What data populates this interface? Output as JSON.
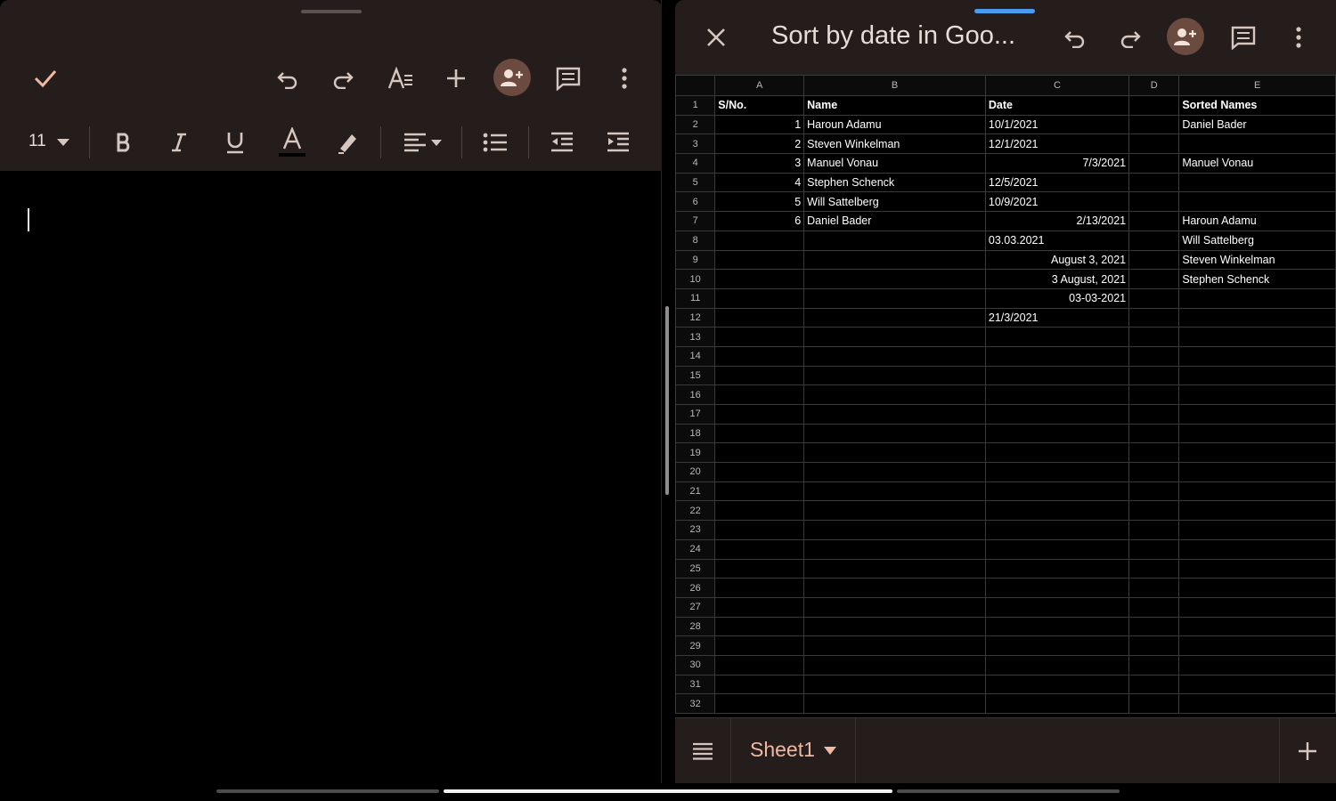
{
  "docs": {
    "font_size": "11"
  },
  "sheets": {
    "title": "Sort by date in Goo...",
    "tab_name": "Sheet1",
    "columns": [
      "A",
      "B",
      "C",
      "D",
      "E"
    ],
    "rows": [
      {
        "n": "1",
        "a": "S/No.",
        "b": "Name",
        "c": "Date",
        "d": "",
        "e": "Sorted Names"
      },
      {
        "n": "2",
        "a": "1",
        "b": "Haroun Adamu",
        "c": "10/1/2021",
        "d": "",
        "e": "Daniel Bader"
      },
      {
        "n": "3",
        "a": "2",
        "b": "Steven Winkelman",
        "c": "12/1/2021",
        "d": "",
        "e": ""
      },
      {
        "n": "4",
        "a": "3",
        "b": "Manuel Vonau",
        "c": "7/3/2021",
        "d": "",
        "e": "Manuel Vonau"
      },
      {
        "n": "5",
        "a": "4",
        "b": "Stephen Schenck",
        "c": "12/5/2021",
        "d": "",
        "e": ""
      },
      {
        "n": "6",
        "a": "5",
        "b": "Will Sattelberg",
        "c": "10/9/2021",
        "d": "",
        "e": ""
      },
      {
        "n": "7",
        "a": "6",
        "b": "Daniel Bader",
        "c": "2/13/2021",
        "d": "",
        "e": "Haroun Adamu"
      },
      {
        "n": "8",
        "a": "",
        "b": "",
        "c": "03.03.2021",
        "d": "",
        "e": "Will Sattelberg"
      },
      {
        "n": "9",
        "a": "",
        "b": "",
        "c": "August 3, 2021",
        "d": "",
        "e": "Steven Winkelman"
      },
      {
        "n": "10",
        "a": "",
        "b": "",
        "c": "3 August, 2021",
        "d": "",
        "e": "Stephen Schenck"
      },
      {
        "n": "11",
        "a": "",
        "b": "",
        "c": "03-03-2021",
        "d": "",
        "e": ""
      },
      {
        "n": "12",
        "a": "",
        "b": "",
        "c": "21/3/2021",
        "d": "",
        "e": ""
      },
      {
        "n": "13",
        "a": "",
        "b": "",
        "c": "",
        "d": "",
        "e": ""
      },
      {
        "n": "14",
        "a": "",
        "b": "",
        "c": "",
        "d": "",
        "e": ""
      },
      {
        "n": "15",
        "a": "",
        "b": "",
        "c": "",
        "d": "",
        "e": ""
      },
      {
        "n": "16",
        "a": "",
        "b": "",
        "c": "",
        "d": "",
        "e": ""
      },
      {
        "n": "17",
        "a": "",
        "b": "",
        "c": "",
        "d": "",
        "e": ""
      },
      {
        "n": "18",
        "a": "",
        "b": "",
        "c": "",
        "d": "",
        "e": ""
      },
      {
        "n": "19",
        "a": "",
        "b": "",
        "c": "",
        "d": "",
        "e": ""
      },
      {
        "n": "20",
        "a": "",
        "b": "",
        "c": "",
        "d": "",
        "e": ""
      },
      {
        "n": "21",
        "a": "",
        "b": "",
        "c": "",
        "d": "",
        "e": ""
      },
      {
        "n": "22",
        "a": "",
        "b": "",
        "c": "",
        "d": "",
        "e": ""
      },
      {
        "n": "23",
        "a": "",
        "b": "",
        "c": "",
        "d": "",
        "e": ""
      },
      {
        "n": "24",
        "a": "",
        "b": "",
        "c": "",
        "d": "",
        "e": ""
      },
      {
        "n": "25",
        "a": "",
        "b": "",
        "c": "",
        "d": "",
        "e": ""
      },
      {
        "n": "26",
        "a": "",
        "b": "",
        "c": "",
        "d": "",
        "e": ""
      },
      {
        "n": "27",
        "a": "",
        "b": "",
        "c": "",
        "d": "",
        "e": ""
      },
      {
        "n": "28",
        "a": "",
        "b": "",
        "c": "",
        "d": "",
        "e": ""
      },
      {
        "n": "29",
        "a": "",
        "b": "",
        "c": "",
        "d": "",
        "e": ""
      },
      {
        "n": "30",
        "a": "",
        "b": "",
        "c": "",
        "d": "",
        "e": ""
      },
      {
        "n": "31",
        "a": "",
        "b": "",
        "c": "",
        "d": "",
        "e": ""
      },
      {
        "n": "32",
        "a": "",
        "b": "",
        "c": "",
        "d": "",
        "e": ""
      }
    ]
  },
  "colors": {
    "toolbar_bg": "#241d1b",
    "accent": "#f0b8a0",
    "avatar_bg": "#6b4a3f",
    "active_handle": "#4a9cf0"
  },
  "icons": {
    "docs": [
      "check-icon",
      "undo-icon",
      "redo-icon",
      "text-format-icon",
      "insert-plus-icon",
      "add-people-icon",
      "comment-icon",
      "more-vert-icon",
      "dropdown-caret-icon",
      "bold-icon",
      "italic-icon",
      "underline-icon",
      "text-color-icon",
      "highlight-icon",
      "align-icon",
      "bulleted-list-icon",
      "decrease-indent-icon",
      "increase-indent-icon"
    ],
    "sheets": [
      "close-icon",
      "undo-icon",
      "redo-icon",
      "add-people-icon",
      "comment-icon",
      "more-vert-icon",
      "all-sheets-menu-icon",
      "add-sheet-icon"
    ]
  }
}
